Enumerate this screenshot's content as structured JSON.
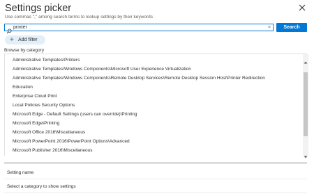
{
  "header": {
    "title": "Settings picker",
    "subtitle": "Use commas \",\" among search terms to lookup settings by their keywords",
    "close_icon": "close-icon"
  },
  "search": {
    "value": "printer",
    "search_icon": "search-icon",
    "clear_glyph": "×",
    "button_label": "Search"
  },
  "filter": {
    "add_filter_label": "Add filter",
    "plus_glyph": "+"
  },
  "browse": {
    "label": "Browse by category",
    "items": [
      "Administrative Templates\\Printers",
      "Administrative Templates\\Windows Components\\Microsoft User Experience Virtualization",
      "Administrative Templates\\Windows Components\\Remote Desktop Services\\Remote Desktop Session Host\\Printer Redirection",
      "Education",
      "Enterprise Cloud Print",
      "Local Policies Security Options",
      "Microsoft Edge - Default Settings (users can override)\\Printing",
      "Microsoft Edge\\Printing",
      "Microsoft Office 2016\\Miscellaneous",
      "Microsoft PowerPoint 2016\\PowerPoint Options\\Advanced",
      "Microsoft Publisher 2016\\Miscellaneous"
    ]
  },
  "settings": {
    "column_header": "Setting name",
    "empty_message": "Select a category to show settings"
  },
  "colors": {
    "accent": "#0078d4",
    "filter_bg": "#e1eff8",
    "text": "#323130"
  }
}
